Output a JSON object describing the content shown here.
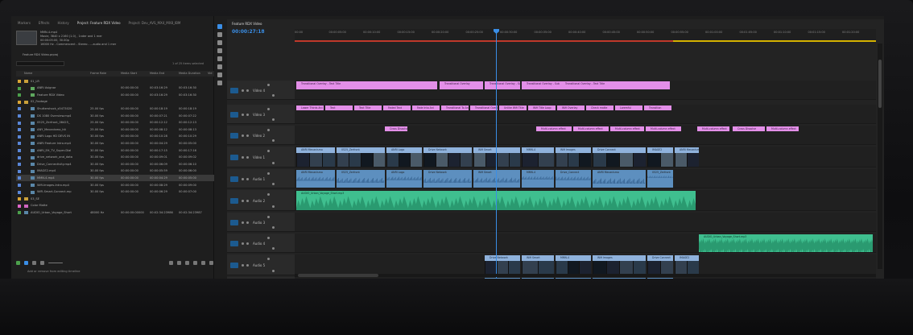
{
  "project_panel": {
    "tabs": [
      "Markers",
      "Effects",
      "History",
      "Project: Feature RDX Video",
      "Project: Dev_AVS_MX4_MX8_IBM"
    ],
    "active_tab": 3,
    "clip_info": [
      "MMN-4.mp4",
      "Movie, 3840 x 2160 (1.0) , 1nder and 1 mer",
      "00:00:05:00, 30.00p",
      "16000 Hz - Commencent - Stereo - ...audio and 1 mer"
    ],
    "project_file": "Feature RDX Video.prproj",
    "search_placeholder": "",
    "item_count": "1 of 25 items selected",
    "columns": [
      "Name",
      "Frame Rate",
      "Media Start",
      "Media End",
      "Media Duration",
      "Vid"
    ],
    "rows": [
      {
        "name": "01_LR",
        "fr": "",
        "ms": "",
        "me": "",
        "md": "",
        "color": "#d9a536",
        "kind": "bin",
        "indent": 0
      },
      {
        "name": "ANRI Asignar",
        "fr": "",
        "ms": "00:00:00:00",
        "me": "00:03:16:29",
        "md": "00:03:16:30",
        "color": "#4ca04c",
        "kind": "seq",
        "indent": 1
      },
      {
        "name": "Feature RDX Video",
        "fr": "",
        "ms": "00:00:00:00",
        "me": "00:03:16:29",
        "md": "00:03:16:30",
        "color": "#4ca04c",
        "kind": "seq",
        "indent": 1
      },
      {
        "name": "02_Footage",
        "fr": "",
        "ms": "",
        "me": "",
        "md": "",
        "color": "#d9a536",
        "kind": "bin",
        "indent": 0
      },
      {
        "name": "Shuttershock_s5473020",
        "fr": "25.00 fps",
        "ms": "00:00:00:00",
        "me": "00:00:18:19",
        "md": "00:00:18:19",
        "color": "#5a87d8",
        "kind": "clip",
        "indent": 1
      },
      {
        "name": "DS 1080 Overview.mp4",
        "fr": "30.00 fps",
        "ms": "00:00:00:00",
        "me": "00:00:07:21",
        "md": "00:00:07:22",
        "color": "#5a87d8",
        "kind": "clip",
        "indent": 1
      },
      {
        "name": "0525_Zerfront_08425_",
        "fr": "25.00 fps",
        "ms": "00:00:00:00",
        "me": "00:00:12:12",
        "md": "00:00:12:13",
        "color": "#5a87d8",
        "kind": "clip",
        "indent": 1
      },
      {
        "name": "ANY_Mecanismo_hit",
        "fr": "25.00 fps",
        "ms": "00:00:00:00",
        "me": "00:00:08:12",
        "md": "00:00:08:13",
        "color": "#5a87d8",
        "kind": "clip",
        "indent": 1
      },
      {
        "name": "ANRI Logo HD DEVS IN",
        "fr": "30.00 fps",
        "ms": "00:00:00:00",
        "me": "00:00:10:28",
        "md": "00:00:10:29",
        "color": "#5a87d8",
        "kind": "clip",
        "indent": 1
      },
      {
        "name": "ANRI Feature Intro.mp4",
        "fr": "30.00 fps",
        "ms": "00:00:00:00",
        "me": "00:00:04:29",
        "md": "00:00:05:00",
        "color": "#5a87d8",
        "kind": "clip",
        "indent": 1
      },
      {
        "name": "ANRI_EH_TV_Super-Dial",
        "fr": "30.00 fps",
        "ms": "00:00:00:00",
        "me": "00:00:17:15",
        "md": "00:00:17:16",
        "color": "#5a87d8",
        "kind": "clip",
        "indent": 1
      },
      {
        "name": "drive_network_and_data",
        "fr": "30.00 fps",
        "ms": "00:00:00:00",
        "me": "00:00:09:01",
        "md": "00:00:09:02",
        "color": "#5a87d8",
        "kind": "clip",
        "indent": 1
      },
      {
        "name": "Drive_Connectivity.mp4",
        "fr": "30.00 fps",
        "ms": "00:00:00:00",
        "me": "00:00:06:09",
        "md": "00:00:06:10",
        "color": "#5a87d8",
        "kind": "clip",
        "indent": 1
      },
      {
        "name": "IMAGE2.mp4",
        "fr": "30.00 fps",
        "ms": "00:00:00:00",
        "me": "00:00:05:59",
        "md": "00:00:06:00",
        "color": "#5a87d8",
        "kind": "clip",
        "indent": 1
      },
      {
        "name": "MMN-4.mp4",
        "fr": "30.00 fps",
        "ms": "00:00:00:00",
        "me": "00:00:04:29",
        "md": "00:00:05:00",
        "color": "#5a87d8",
        "kind": "clip",
        "indent": 1,
        "selected": true
      },
      {
        "name": "Wifi-Images-Intro.mp4",
        "fr": "30.00 fps",
        "ms": "00:00:00:00",
        "me": "00:00:08:29",
        "md": "00:00:09:00",
        "color": "#5a87d8",
        "kind": "clip",
        "indent": 1
      },
      {
        "name": "WiFi-Smart-Connect.mp",
        "fr": "30.00 fps",
        "ms": "00:00:00:00",
        "me": "00:00:06:29",
        "md": "00:00:07:00",
        "color": "#5a87d8",
        "kind": "clip",
        "indent": 1
      },
      {
        "name": "03_SE",
        "fr": "",
        "ms": "",
        "me": "",
        "md": "",
        "color": "#d9a536",
        "kind": "bin",
        "indent": 0
      },
      {
        "name": "Color Matte",
        "fr": "",
        "ms": "",
        "me": "",
        "md": "",
        "color": "#e066c8",
        "kind": "matte",
        "indent": 0
      },
      {
        "name": "AUDIO_Urban_Voyage_Short",
        "fr": "48000 Hz",
        "ms": "00:00:00:00000",
        "me": "00:02:34:23986",
        "md": "00:02:34:23987",
        "color": "#4ca04c",
        "kind": "audio",
        "indent": 0
      }
    ],
    "status": "Add or remove from editing timeline"
  },
  "timeline": {
    "tab_title": "Feature RDX Video",
    "timecode": "00:00:27:18",
    "ruler_ticks": [
      "00:00",
      "00:00:05:00",
      "00:00:10:00",
      "00:00:15:00",
      "00:00:20:00",
      "00:00:25:00",
      "00:00:30:00",
      "00:00:35:00",
      "00:00:40:00",
      "00:00:45:00",
      "00:00:50:00",
      "00:00:55:00",
      "00:01:00:00",
      "00:01:05:00",
      "00:01:10:00",
      "00:01:15:00",
      "00:01:20:00"
    ],
    "tracks": [
      {
        "name": "Video 4",
        "kind": "v"
      },
      {
        "name": "Video 3",
        "kind": "v"
      },
      {
        "name": "Video 2",
        "kind": "v"
      },
      {
        "name": "Video 1",
        "kind": "v"
      },
      {
        "name": "Audio 1",
        "kind": "a"
      },
      {
        "name": "Audio 2",
        "kind": "a"
      },
      {
        "name": "Audio 3",
        "kind": "a"
      },
      {
        "name": "Audio 4",
        "kind": "a"
      },
      {
        "name": "Audio 5",
        "kind": "a"
      },
      {
        "name": "Audio 2",
        "kind": "a"
      }
    ],
    "clip_labels": {
      "v4": [
        "Transitional Overlay - Text Title",
        "Transitional Overlay",
        "Transitional Overlay - Sub",
        "Transitional Overlay - Sub Title",
        "Transitional Overlay - Text Title"
      ],
      "v3": [
        "Lower Thirds Ani",
        "Text",
        "Text Title",
        "Faded Text",
        "Fade Into Ani",
        "Transitional To Ani",
        "Transitional Overlay - Sub Title",
        "Unlike Wifi Title",
        "Wifi Title Loop",
        "Wifi Overlay",
        "Check matte",
        "Loremful",
        "Transition"
      ],
      "v2": [
        "Cross Dissolve",
        "Multi-column effect",
        "Multi-column effect",
        "Multi-column effect",
        "Multi-column effect",
        "Multi-column effect"
      ],
      "v1": [
        "ANRI Mecanismo",
        "0525_Zerfront",
        "ANRI Logo",
        "Drive Network",
        "Wifi Smart",
        "MMN-4",
        "Wifi Images",
        "Drive Connect",
        "IMAGE2"
      ],
      "a1": [
        "ANRI Mecanismo",
        "0525_Zerfront",
        "ANRI Logo",
        "Drive Network",
        "Wifi Smart",
        "MMN-4",
        "Drive_Connect"
      ],
      "a2": [
        "AUDIO_Urban_Voyage_Short.mp3"
      ]
    }
  }
}
